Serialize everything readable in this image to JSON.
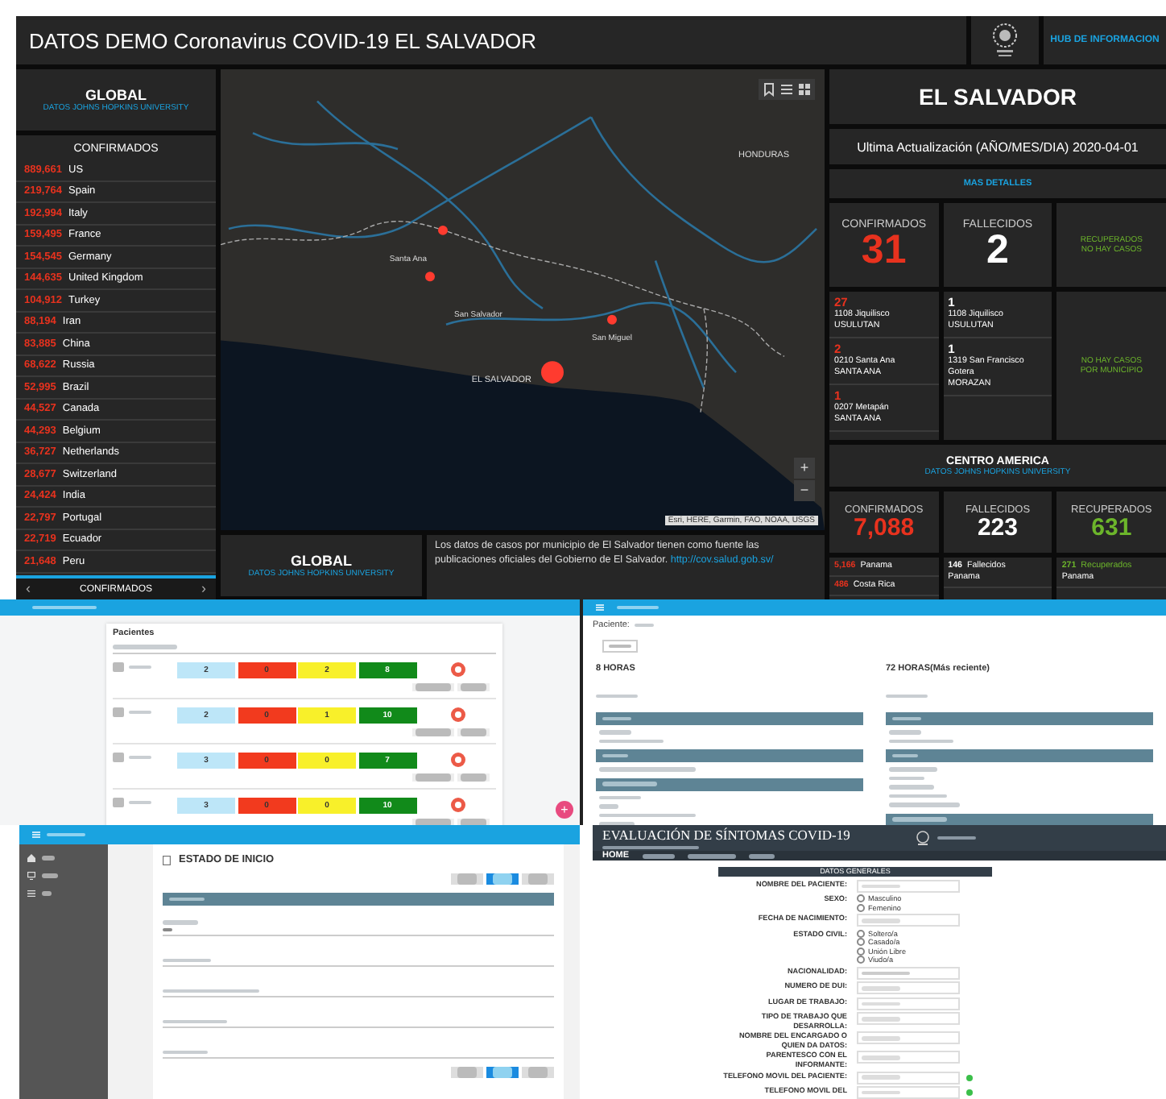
{
  "dashboard": {
    "title": "DATOS DEMO Coronavirus COVID-19 EL SALVADOR",
    "hub_link": "HUB DE INFORMACION",
    "global_card": {
      "title": "GLOBAL",
      "subtitle": "DATOS JOHNS HOPKINS UNIVERSITY"
    },
    "confirmed_list": {
      "title": "CONFIRMADOS",
      "rows": [
        {
          "value": "889,661",
          "country": "US"
        },
        {
          "value": "219,764",
          "country": "Spain"
        },
        {
          "value": "192,994",
          "country": "Italy"
        },
        {
          "value": "159,495",
          "country": "France"
        },
        {
          "value": "154,545",
          "country": "Germany"
        },
        {
          "value": "144,635",
          "country": "United Kingdom"
        },
        {
          "value": "104,912",
          "country": "Turkey"
        },
        {
          "value": "88,194",
          "country": "Iran"
        },
        {
          "value": "83,885",
          "country": "China"
        },
        {
          "value": "68,622",
          "country": "Russia"
        },
        {
          "value": "52,995",
          "country": "Brazil"
        },
        {
          "value": "44,527",
          "country": "Canada"
        },
        {
          "value": "44,293",
          "country": "Belgium"
        },
        {
          "value": "36,727",
          "country": "Netherlands"
        },
        {
          "value": "28,677",
          "country": "Switzerland"
        },
        {
          "value": "24,424",
          "country": "India"
        },
        {
          "value": "22,797",
          "country": "Portugal"
        },
        {
          "value": "22,719",
          "country": "Ecuador"
        },
        {
          "value": "21,648",
          "country": "Peru"
        }
      ],
      "footer": {
        "prev": "‹",
        "label": "CONFIRMADOS",
        "next": "›"
      }
    },
    "map": {
      "labels": [
        "HONDURAS",
        "Santa Ana",
        "San Salvador",
        "San Miguel",
        "EL SALVADOR"
      ],
      "attribution": "Esri, HERE, Garmin, FAO, NOAA, USGS",
      "zoom_in": "+",
      "zoom_out": "−"
    },
    "global_card_bottom": {
      "title": "GLOBAL",
      "subtitle": "DATOS JOHNS HOPKINS UNIVERSITY"
    },
    "source_note": {
      "text": "Los datos de casos por municipio de El Salvador tienen como fuente las publicaciones oficiales del Gobierno de El Salvador.",
      "link": "http://cov.salud.gob.sv/"
    },
    "country": {
      "title": "EL SALVADOR",
      "update": "Ultima Actualización (AÑO/MES/DIA) 2020-04-01",
      "details_link": "MAS DETALLES",
      "stats": [
        {
          "kind": "big",
          "label": "CONFIRMADOS",
          "value": "31",
          "color": "#e8321e"
        },
        {
          "kind": "big",
          "label": "FALLECIDOS",
          "value": "2",
          "color": "#ffffff"
        },
        {
          "kind": "note",
          "lines": [
            "RECUPERADOS",
            "NO HAY CASOS"
          ],
          "color": "#6cb52b"
        }
      ],
      "municipalities": [
        {
          "kind": "list",
          "color": "#e8321e",
          "entries": [
            {
              "count": "27",
              "place": "1108 Jiquilisco",
              "dept": "USULUTAN"
            },
            {
              "count": "2",
              "place": "0210 Santa Ana",
              "dept": "SANTA ANA"
            },
            {
              "count": "1",
              "place": "0207 Metapán",
              "dept": "SANTA ANA"
            }
          ]
        },
        {
          "kind": "list",
          "color": "#ffffff",
          "entries": [
            {
              "count": "1",
              "place": "1108 Jiquilisco",
              "dept": "USULUTAN"
            },
            {
              "count": "1",
              "place": "1319 San Francisco Gotera",
              "dept": "MORAZAN"
            }
          ]
        },
        {
          "kind": "note",
          "color": "#6cb52b",
          "lines": [
            "NO HAY CASOS",
            "POR MUNICIPIO"
          ]
        }
      ]
    },
    "central_america": {
      "title": "CENTRO AMERICA",
      "subtitle": "DATOS JOHNS HOPKINS UNIVERSITY",
      "stats": [
        {
          "label": "CONFIRMADOS",
          "value": "7,088",
          "color": "#e8321e"
        },
        {
          "label": "FALLECIDOS",
          "value": "223",
          "color": "#ffffff"
        },
        {
          "label": "RECUPERADOS",
          "value": "631",
          "color": "#6cb52b"
        }
      ],
      "lists": [
        {
          "color": "#e8321e",
          "entries": [
            {
              "count": "5,166",
              "label": "Panama"
            },
            {
              "count": "486",
              "label": "Costa Rica"
            }
          ]
        },
        {
          "color": "#ffffff",
          "entries": [
            {
              "count": "146",
              "label": "Fallecidos",
              "place": "Panama"
            }
          ]
        },
        {
          "color": "#6cb52b",
          "entries": [
            {
              "count": "271",
              "label": "Recuperados",
              "place": "Panama"
            }
          ]
        }
      ]
    }
  },
  "patients_app": {
    "heading": "Pacientes",
    "rows": [
      {
        "counts": [
          "2",
          "0",
          "2",
          "8"
        ]
      },
      {
        "counts": [
          "2",
          "0",
          "1",
          "10"
        ]
      },
      {
        "counts": [
          "3",
          "0",
          "0",
          "7"
        ]
      },
      {
        "counts": [
          "3",
          "0",
          "0",
          "10"
        ]
      }
    ],
    "fab": "+"
  },
  "compare_app": {
    "patient_label": "Paciente:",
    "columns": [
      {
        "title": "8 HORAS"
      },
      {
        "title": "72 HORAS(Más reciente)"
      }
    ]
  },
  "start_app": {
    "heading": "ESTADO DE INICIO"
  },
  "eval_app": {
    "title": "EVALUACIÓN DE SÍNTOMAS COVID-19",
    "nav": [
      "HOME"
    ],
    "section": "DATOS GENERALES",
    "rows": [
      {
        "kind": "field",
        "label": "NOMBRE DEL PACIENTE:"
      },
      {
        "kind": "radios",
        "label": "SEXO:",
        "options": [
          {
            "label": "Masculino",
            "selected": false
          },
          {
            "label": "Femenino",
            "selected": false
          }
        ]
      },
      {
        "kind": "field",
        "label": "FECHA DE NACIMIENTO:"
      },
      {
        "kind": "radios",
        "label": "ESTADO CIVIL:",
        "options": [
          {
            "label": "Soltero/a",
            "selected": false
          },
          {
            "label": "Casado/a",
            "selected": false
          },
          {
            "label": "Unión Libre",
            "selected": false
          },
          {
            "label": "Viudo/a",
            "selected": false
          }
        ]
      },
      {
        "kind": "select",
        "label": "NACIONALIDAD:"
      },
      {
        "kind": "field",
        "label": "NUMERO DE DUI:"
      },
      {
        "kind": "field",
        "label": "LUGAR DE TRABAJO:"
      },
      {
        "kind": "field",
        "label": "TIPO DE TRABAJO QUE DESARROLLA:"
      },
      {
        "kind": "field",
        "label": "NOMBRE DEL ENCARGADO O QUIEN DA DATOS:"
      },
      {
        "kind": "field",
        "label": "PARENTESCO CON EL INFORMANTE:"
      },
      {
        "kind": "phone",
        "label": "TELEFONO MOVIL DEL PACIENTE:"
      },
      {
        "kind": "phone",
        "label": "TELEFONO MOVIL DEL"
      }
    ]
  }
}
